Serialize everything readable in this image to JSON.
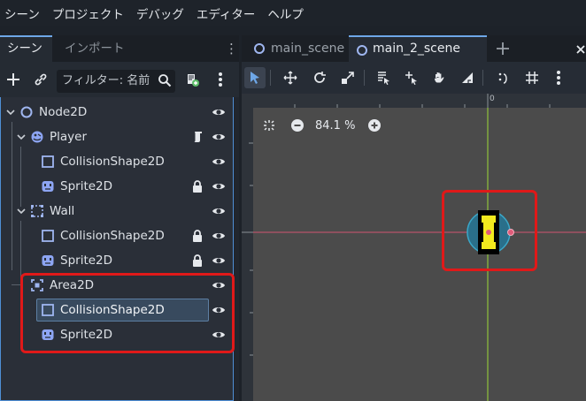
{
  "menubar": [
    "シーン",
    "プロジェクト",
    "デバッグ",
    "エディター",
    "ヘルプ"
  ],
  "dock": {
    "tab_scene": "シーン",
    "tab_import": "インポート",
    "filter_placeholder": "フィルター: 名前"
  },
  "tree": [
    {
      "label": "Node2D",
      "icon": "node2d-circle-icon",
      "visible": true
    },
    {
      "label": "Player",
      "icon": "characterbody2d-icon",
      "script": true,
      "visible": true
    },
    {
      "label": "CollisionShape2D",
      "icon": "collisionshape2d-icon",
      "visible": true
    },
    {
      "label": "Sprite2D",
      "icon": "sprite2d-icon",
      "locked": true,
      "visible": true
    },
    {
      "label": "Wall",
      "icon": "staticbody2d-icon",
      "visible": true
    },
    {
      "label": "CollisionShape2D",
      "icon": "collisionshape2d-icon",
      "locked": true,
      "visible": true
    },
    {
      "label": "Sprite2D",
      "icon": "sprite2d-icon",
      "locked": true,
      "visible": true
    },
    {
      "label": "Area2D",
      "icon": "area2d-icon",
      "visible": true
    },
    {
      "label": "CollisionShape2D",
      "icon": "collisionshape2d-icon",
      "visible": true,
      "selected": true
    },
    {
      "label": "Sprite2D",
      "icon": "sprite2d-icon",
      "visible": true
    }
  ],
  "editor": {
    "tabs": [
      "main_scene",
      "main_2_scene"
    ],
    "active_tab": "main_2_scene",
    "zoom": "84.1 %",
    "ruler_origin": "0"
  },
  "colors": {
    "accent": "#6ea7e8",
    "highlight_red": "#e01919",
    "viewport_bg": "#4b4b4b"
  }
}
